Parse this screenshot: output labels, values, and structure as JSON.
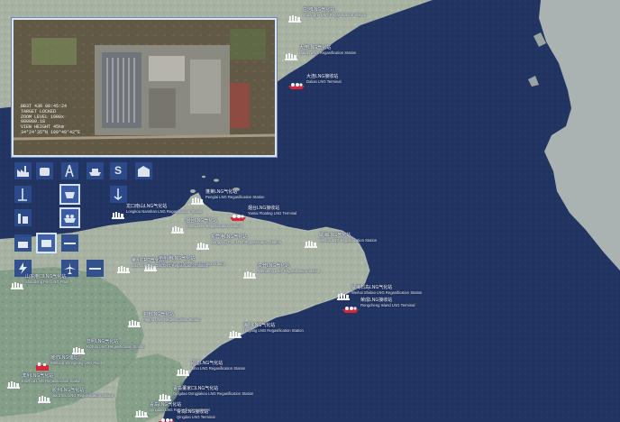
{
  "inset": {
    "lines": [
      "BB3T 43R 08:45:24",
      "TARGET LOCKED",
      "ZOOM LEVEL 1000x",
      "000000.18",
      "",
      "VIEW HEIGHT 45km",
      "34°24'35\"N 109°49'42\"E"
    ]
  },
  "tools": {
    "s_label": "S"
  },
  "terminals": [
    {
      "cn": "莱州港LNG气化站",
      "en": "Laizhou Port LNG Regasification Station"
    },
    {
      "cn": "龙口南山LNG气化站",
      "en": "Longkou Nanshan LNG Regasification Station"
    },
    {
      "cn": "蓬莱LNG气化站",
      "en": "Penglai LNG Regasification Station"
    },
    {
      "cn": "烟台LNG接收站",
      "en": "Yantai Floating LNG Terminal"
    },
    {
      "cn": "烟台LNG气化站",
      "en": "Yantai LNG Regasification Station"
    },
    {
      "cn": "东营港LNG气化站",
      "en": "Dongying Port LNG Regasification Station"
    },
    {
      "cn": "威海LNG气化站",
      "en": "Weihai LNG Regasification Station"
    },
    {
      "cn": "莱州CRC气化站",
      "en": "Laizhou CRC Gas LNG Regasification Station"
    },
    {
      "cn": "文登LNG气化站",
      "en": "Wendeng LNG Regasification Station"
    },
    {
      "cn": "威海石岛LNG气化站",
      "en": "Weihai Shidao LNG Regasification Station"
    },
    {
      "cn": "荣成LNG接收站",
      "en": "Rongcheng Island LNG Terminal"
    },
    {
      "cn": "山东港口LNG气化站",
      "en": "Shandong Port LNG Plant"
    },
    {
      "cn": "平度LNG气化站",
      "en": "Pingdu LNG Regasification Station"
    },
    {
      "cn": "海阳LNG气化站",
      "en": "Haiyang LNG Regasification Station"
    },
    {
      "cn": "即墨LNG气化站",
      "en": "Jimo LNG Regasification Station"
    },
    {
      "cn": "胶州LNG气化站",
      "en": "Jiaozhou LNG Regasification Station"
    },
    {
      "cn": "潍坊LNG储配厂",
      "en": "Weifang Zhongtong LNG Plant"
    },
    {
      "cn": "青岛董家口LNG气化站",
      "en": "Qingdao Dongjiakou LNG Regasification Station"
    },
    {
      "cn": "青岛LNG气化站",
      "en": "Qingdao LNG Regasification Station"
    },
    {
      "cn": "青岛LNG接收站",
      "en": "Qingdao LNG Terminal"
    },
    {
      "cn": "大连LNG接收站",
      "en": "Dalian LNG Terminal"
    },
    {
      "cn": "大连LNG气化站",
      "en": "Dalian LNG Regasification Station"
    },
    {
      "cn": "庄河LNG气化站",
      "en": "Zhuanghe LNG Regasification Station"
    },
    {
      "cn": "日照LNG气化站",
      "en": "Rizhao LNG Regasification Station"
    },
    {
      "cn": "滨州LNG气化站",
      "en": "Binzhou LNG Regasification Station"
    }
  ]
}
